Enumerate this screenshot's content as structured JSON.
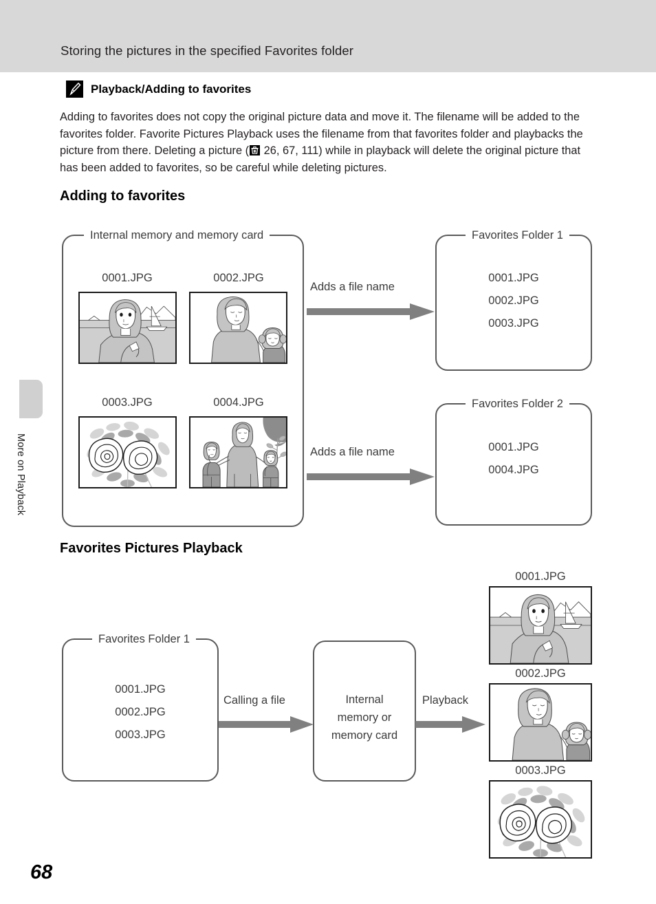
{
  "header": {
    "title": "Storing the pictures in the specified Favorites folder"
  },
  "note": {
    "icon": "pencil-note-icon",
    "title": "Playback/Adding to favorites",
    "body_part1": "Adding to favorites does not copy the original picture data and move it. The filename will be added to the favorites folder. Favorite Pictures Playback uses the filename from that favorites folder and playbacks the picture from there. Deleting a picture (",
    "inline_icon": "delete-trash-icon",
    "body_part2": " 26, 67, 111) while in playback will delete the original picture that has been added to favorites, so be careful while deleting pictures."
  },
  "sections": {
    "adding": "Adding to favorites",
    "playback": "Favorites Pictures Playback"
  },
  "diagram_adding": {
    "source_box": {
      "legend": "Internal memory and memory card",
      "thumbnails": [
        {
          "caption": "0001.JPG",
          "art": "woman-by-the-sea"
        },
        {
          "caption": "0002.JPG",
          "art": "woman-and-girl"
        },
        {
          "caption": "0003.JPG",
          "art": "roses-and-leaves"
        },
        {
          "caption": "0004.JPG",
          "art": "mother-with-two-children"
        }
      ]
    },
    "arrow1_label": "Adds a file name",
    "arrow2_label": "Adds a file name",
    "folder1": {
      "legend": "Favorites Folder 1",
      "files": [
        "0001.JPG",
        "0002.JPG",
        "0003.JPG"
      ]
    },
    "folder2": {
      "legend": "Favorites Folder 2",
      "files": [
        "0001.JPG",
        "0004.JPG"
      ]
    }
  },
  "diagram_playback": {
    "folder1": {
      "legend": "Favorites Folder 1",
      "files": [
        "0001.JPG",
        "0002.JPG",
        "0003.JPG"
      ]
    },
    "arrow1_label": "Calling a file",
    "memory_box_text": "Internal\nmemory or\nmemory card",
    "memory_box_lines": [
      "Internal",
      "memory or",
      "memory card"
    ],
    "arrow2_label": "Playback",
    "results": [
      {
        "caption": "0001.JPG",
        "art": "woman-by-the-sea"
      },
      {
        "caption": "0002.JPG",
        "art": "woman-and-girl"
      },
      {
        "caption": "0003.JPG",
        "art": "roses-and-leaves"
      }
    ]
  },
  "side_tab": {
    "label": "More on Playback"
  },
  "page_number": "68",
  "colors": {
    "header_band": "#d8d8d8",
    "box_border": "#595959",
    "arrow": "#808080",
    "text": "#231f20"
  }
}
